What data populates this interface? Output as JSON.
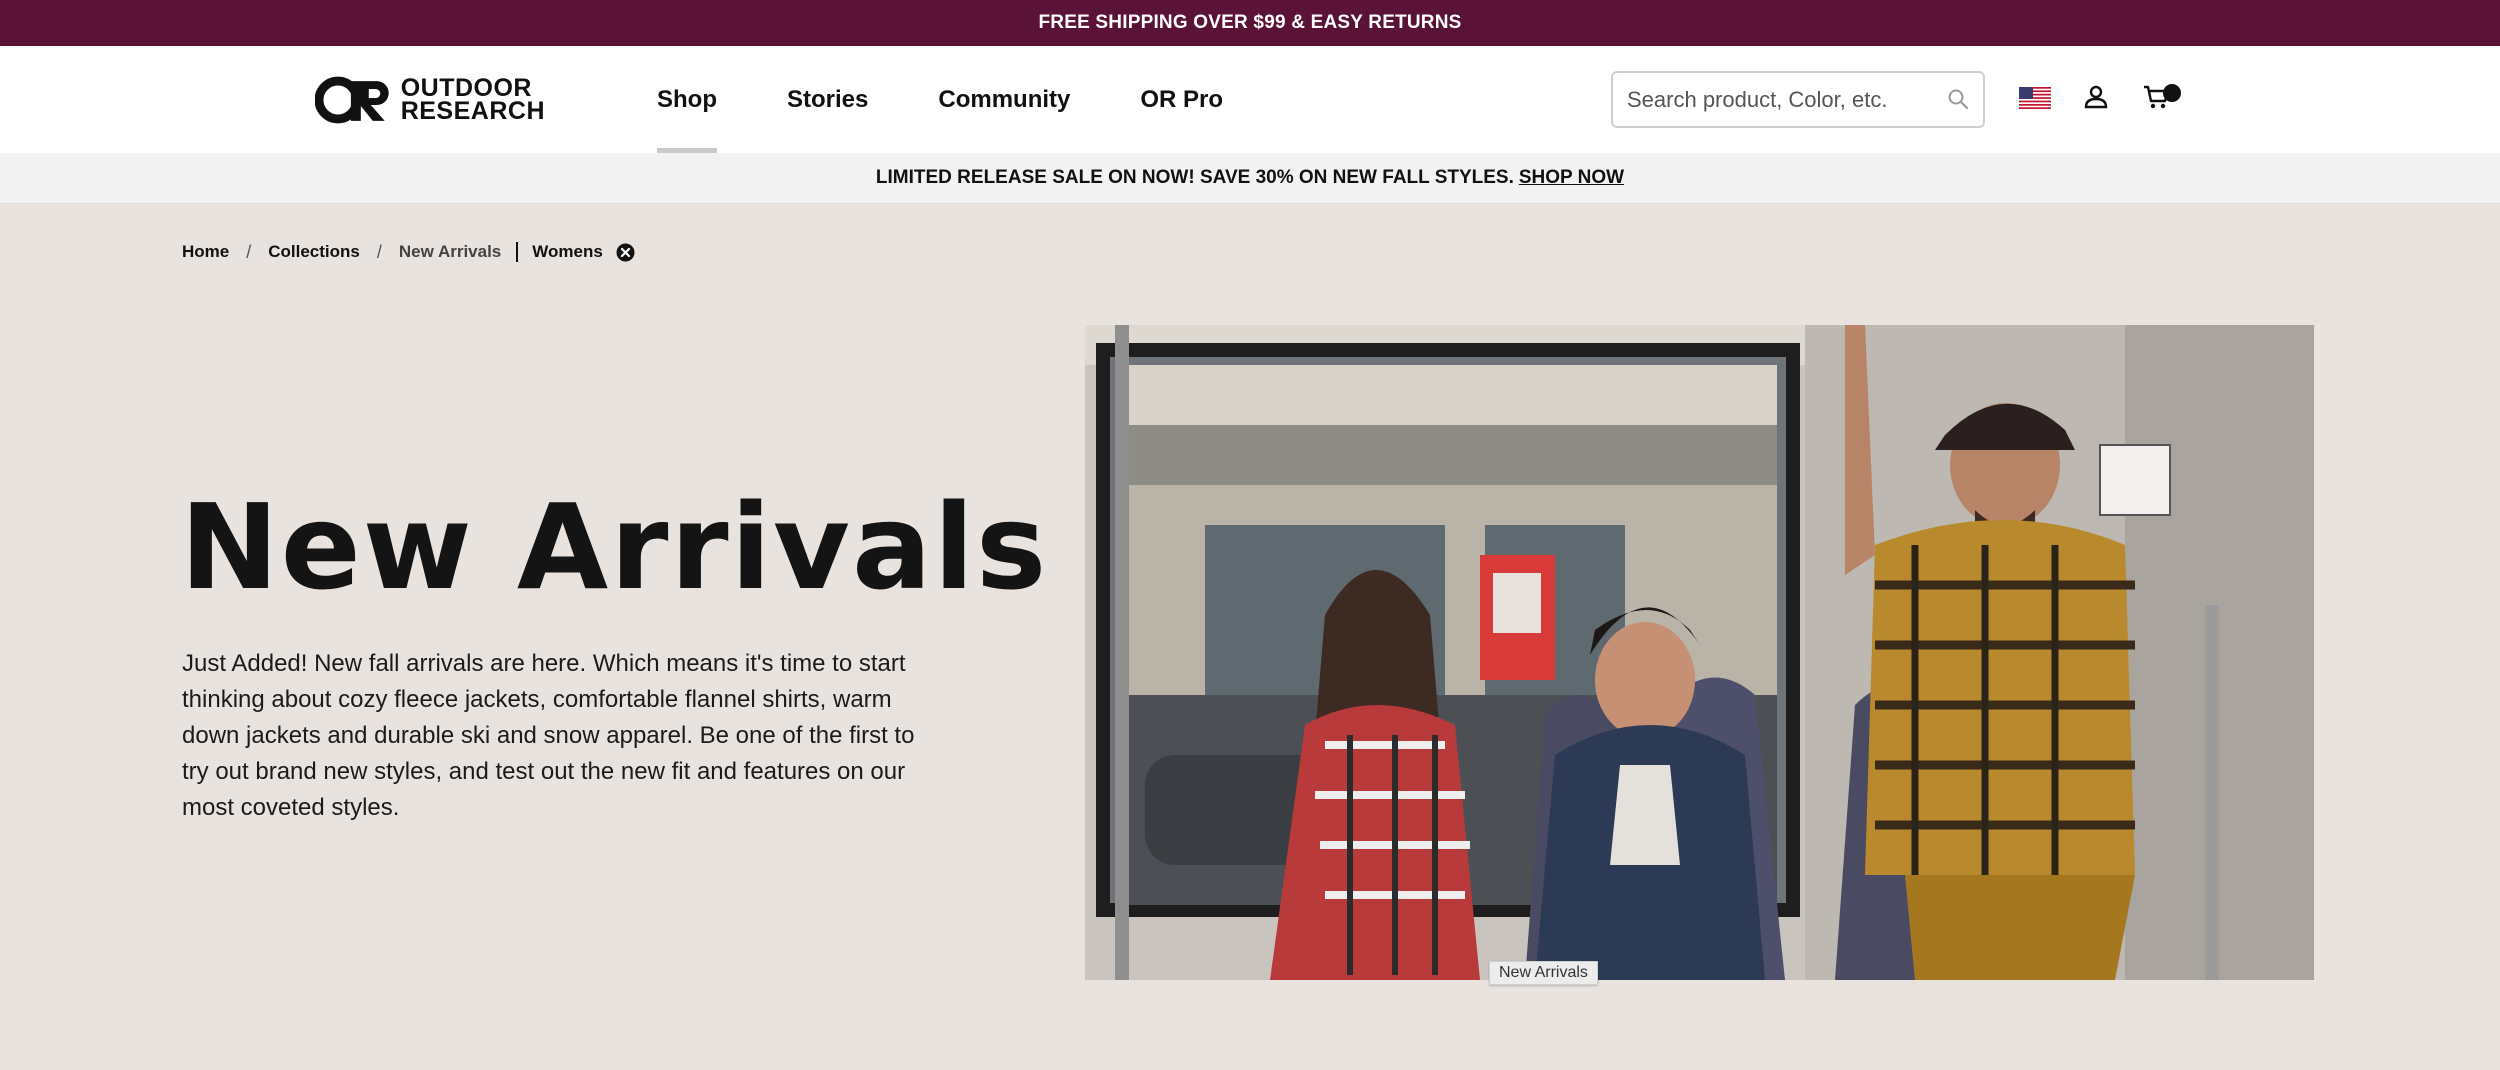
{
  "promo": {
    "text": "FREE SHIPPING OVER $99 & EASY RETURNS"
  },
  "brand": {
    "line1": "OUTDOOR",
    "line2": "RESEARCH"
  },
  "nav": {
    "items": [
      {
        "label": "Shop"
      },
      {
        "label": "Stories"
      },
      {
        "label": "Community"
      },
      {
        "label": "OR Pro"
      }
    ],
    "active": "Shop"
  },
  "search": {
    "placeholder": "Search product, Color, etc.",
    "value": ""
  },
  "icons": {
    "search": "search-icon",
    "flag": "us-flag-icon",
    "account": "user-icon",
    "cart": "cart-icon"
  },
  "sale_banner": {
    "text": "LIMITED RELEASE SALE ON NOW! SAVE 30% ON NEW FALL STYLES.",
    "link": "SHOP NOW"
  },
  "breadcrumb": {
    "items": [
      "Home",
      "Collections",
      "New Arrivals"
    ],
    "separator": "/",
    "filter": "Womens"
  },
  "hero": {
    "title": "New Arrivals",
    "description": "Just Added! New fall arrivals are here. Which means it's time to start thinking about cozy fleece jackets, comfortable flannel shirts, warm down jackets and durable ski and snow apparel. Be one of the first to try out brand new styles, and test out the new fit and features on our most coveted styles.",
    "image_tooltip": "New Arrivals"
  },
  "colors": {
    "promo_bg": "#5b1237",
    "page_bg": "#e8e3df",
    "text": "#111111"
  }
}
